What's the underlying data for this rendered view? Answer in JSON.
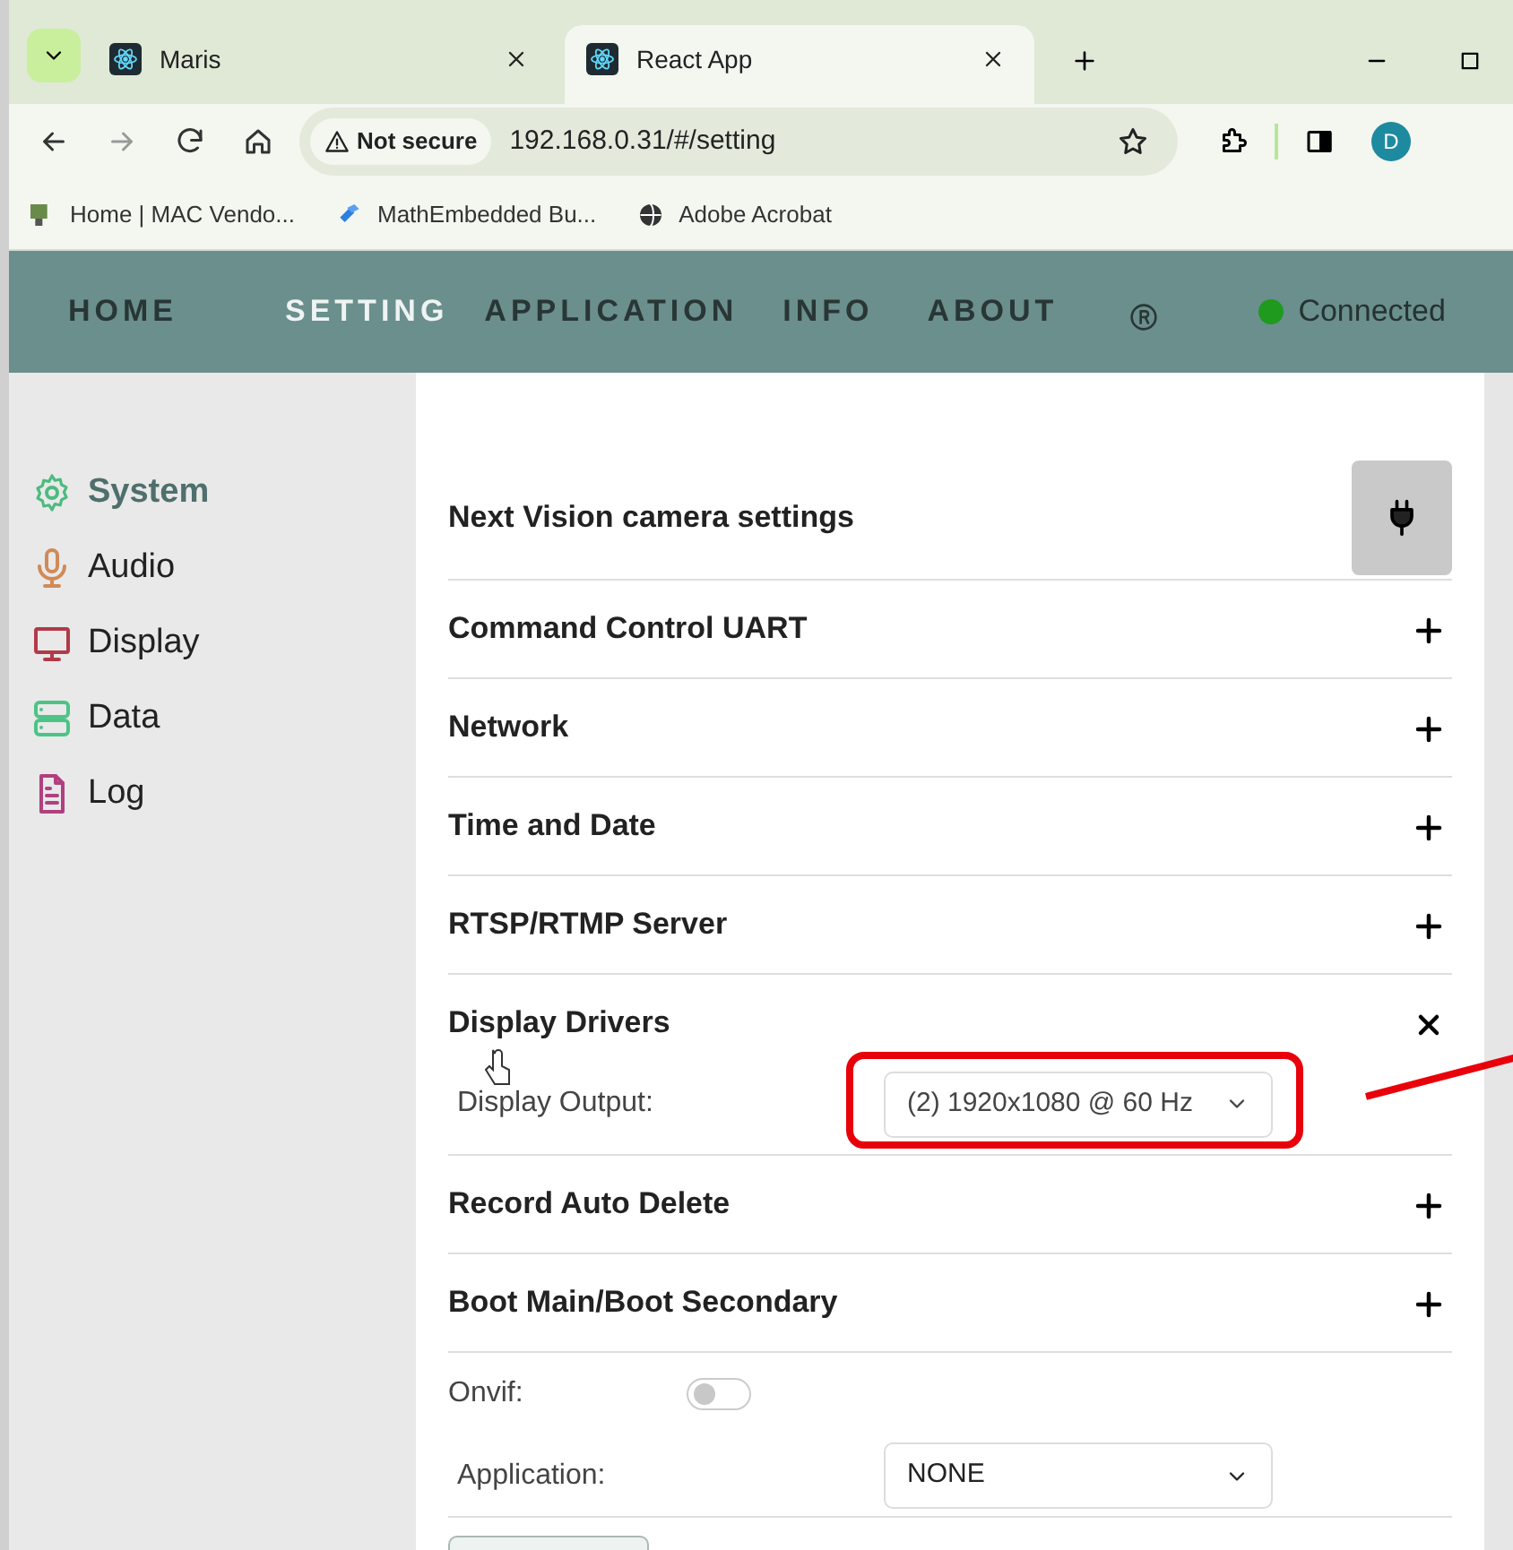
{
  "browser": {
    "tabs": [
      {
        "title": "Maris",
        "selected": false
      },
      {
        "title": "React App",
        "selected": true
      }
    ],
    "security": "Not secure",
    "url": "192.168.0.31/#/setting",
    "profile_initial": "D",
    "bookmarks": [
      "Home | MAC Vendo...",
      "MathEmbedded Bu...",
      "Adobe Acrobat"
    ]
  },
  "nav": {
    "items": [
      {
        "label": "HOME",
        "selected": false
      },
      {
        "label": "SETTING",
        "selected": true
      },
      {
        "label": "APPLICATION",
        "selected": false
      },
      {
        "label": "INFO",
        "selected": false
      },
      {
        "label": "ABOUT",
        "selected": false
      }
    ],
    "status": "Connected",
    "connected": true
  },
  "sidebar": {
    "items": [
      {
        "label": "System",
        "selected": true,
        "color": "#4cbb7f"
      },
      {
        "label": "Audio",
        "selected": false,
        "color": "#d08a58"
      },
      {
        "label": "Display",
        "selected": false,
        "color": "#b23a48"
      },
      {
        "label": "Data",
        "selected": false,
        "color": "#4cc486"
      },
      {
        "label": "Log",
        "selected": false,
        "color": "#b0407f"
      }
    ]
  },
  "content": {
    "title": "Next Vision camera settings",
    "sections": [
      {
        "title": "Command Control UART",
        "expanded": false
      },
      {
        "title": "Network",
        "expanded": false
      },
      {
        "title": "Time and Date",
        "expanded": false
      },
      {
        "title": "RTSP/RTMP Server",
        "expanded": false
      },
      {
        "title": "Display Drivers",
        "expanded": true,
        "fields": [
          {
            "label": "Display Output:",
            "value": "(2) 1920x1080 @ 60 Hz"
          }
        ]
      },
      {
        "title": "Record Auto Delete",
        "expanded": false
      },
      {
        "title": "Boot Main/Boot Secondary",
        "expanded": false
      }
    ],
    "onvif": {
      "label": "Onvif:",
      "on": false
    },
    "application": {
      "label": "Application:",
      "value": "NONE"
    }
  }
}
